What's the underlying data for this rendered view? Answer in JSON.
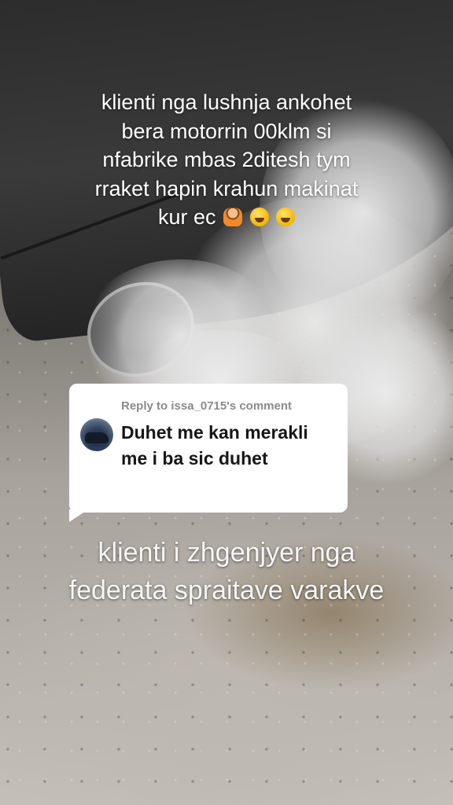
{
  "overlay_top": {
    "lines": [
      "klienti nga lushnja ankohet",
      "bera motorrin 00klm si",
      "nfabrike mbas 2ditesh tym",
      "rraket hapin krahun makinat",
      "kur ec"
    ],
    "emojis": [
      "person-shrugging-icon",
      "rolling-laughing-icon",
      "tears-of-joy-icon"
    ]
  },
  "reply_card": {
    "header": "Reply to issa_0715's comment",
    "text": "Duhet me kan merakli me i ba sic duhet"
  },
  "overlay_bottom": {
    "lines": [
      "klienti i zhgenjyer nga",
      "federata spraitave varakve"
    ]
  }
}
